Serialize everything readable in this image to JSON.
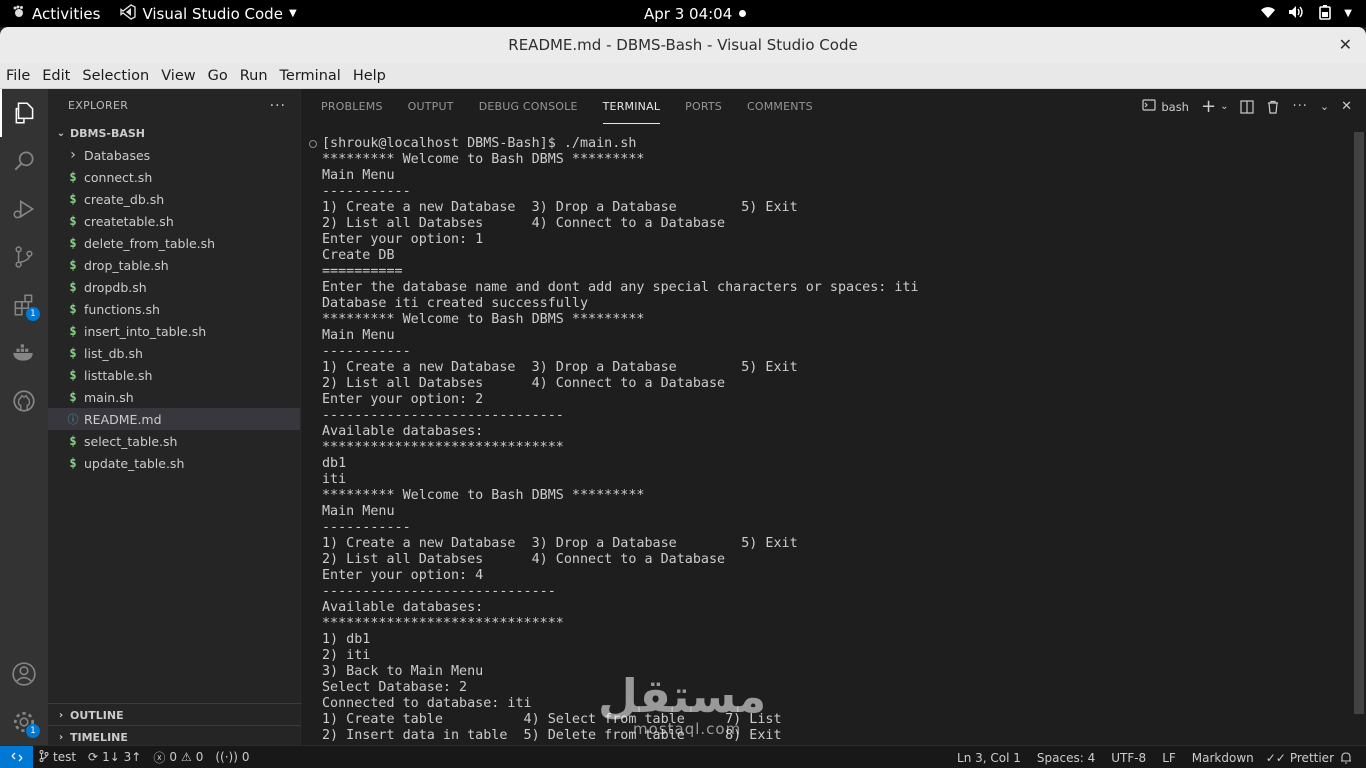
{
  "gnome": {
    "activities": "Activities",
    "app_name": "Visual Studio Code",
    "clock": "Apr 3  04:04"
  },
  "window": {
    "title": "README.md - DBMS-Bash - Visual Studio Code"
  },
  "menu": [
    "File",
    "Edit",
    "Selection",
    "View",
    "Go",
    "Run",
    "Terminal",
    "Help"
  ],
  "activity_bar": {
    "extensions_badge": "1",
    "settings_badge": "1"
  },
  "explorer": {
    "header": "EXPLORER",
    "more": "···",
    "folder": "DBMS-BASH",
    "items": [
      {
        "label": "Databases",
        "type": "folder"
      },
      {
        "label": "connect.sh",
        "type": "sh"
      },
      {
        "label": "create_db.sh",
        "type": "sh"
      },
      {
        "label": "createtable.sh",
        "type": "sh"
      },
      {
        "label": "delete_from_table.sh",
        "type": "sh"
      },
      {
        "label": "drop_table.sh",
        "type": "sh"
      },
      {
        "label": "dropdb.sh",
        "type": "sh"
      },
      {
        "label": "functions.sh",
        "type": "sh"
      },
      {
        "label": "insert_into_table.sh",
        "type": "sh"
      },
      {
        "label": "list_db.sh",
        "type": "sh"
      },
      {
        "label": "listtable.sh",
        "type": "sh"
      },
      {
        "label": "main.sh",
        "type": "sh"
      },
      {
        "label": "README.md",
        "type": "md",
        "selected": true
      },
      {
        "label": "select_table.sh",
        "type": "sh"
      },
      {
        "label": "update_table.sh",
        "type": "sh"
      }
    ],
    "outline": "OUTLINE",
    "timeline": "TIMELINE"
  },
  "panel": {
    "tabs": [
      "PROBLEMS",
      "OUTPUT",
      "DEBUG CONSOLE",
      "TERMINAL",
      "PORTS",
      "COMMENTS"
    ],
    "active_tab": "TERMINAL",
    "shell": "bash"
  },
  "terminal_lines": [
    "[shrouk@localhost DBMS-Bash]$ ./main.sh",
    "********* Welcome to Bash DBMS *********",
    "Main Menu",
    "-----------",
    "1) Create a new Database  3) Drop a Database        5) Exit",
    "2) List all Databses      4) Connect to a Database",
    "Enter your option: 1",
    "Create DB",
    "==========",
    "Enter the database name and dont add any special characters or spaces: iti",
    "Database iti created successfully",
    "********* Welcome to Bash DBMS *********",
    "Main Menu",
    "-----------",
    "1) Create a new Database  3) Drop a Database        5) Exit",
    "2) List all Databses      4) Connect to a Database",
    "Enter your option: 2",
    "------------------------------",
    "Available databases:",
    "******************************",
    "db1",
    "iti",
    "********* Welcome to Bash DBMS *********",
    "Main Menu",
    "-----------",
    "1) Create a new Database  3) Drop a Database        5) Exit",
    "2) List all Databses      4) Connect to a Database",
    "Enter your option: 4",
    "-----------------------------",
    "Available databases:",
    "******************************",
    "1) db1",
    "2) iti",
    "3) Back to Main Menu",
    "Select Database: 2",
    "Connected to database: iti",
    "1) Create table          4) Select from table     7) List",
    "2) Insert data in table  5) Delete from table     8) Exit"
  ],
  "watermark": {
    "arabic": "مستقل",
    "latin": "mostaql.com"
  },
  "status": {
    "branch": "test",
    "sync": "1↓ 3↑",
    "errors": "0",
    "warnings": "0",
    "ports": "0",
    "position": "Ln 3, Col 1",
    "spaces": "Spaces: 4",
    "encoding": "UTF-8",
    "eol": "LF",
    "language": "Markdown",
    "formatter": "Prettier"
  }
}
